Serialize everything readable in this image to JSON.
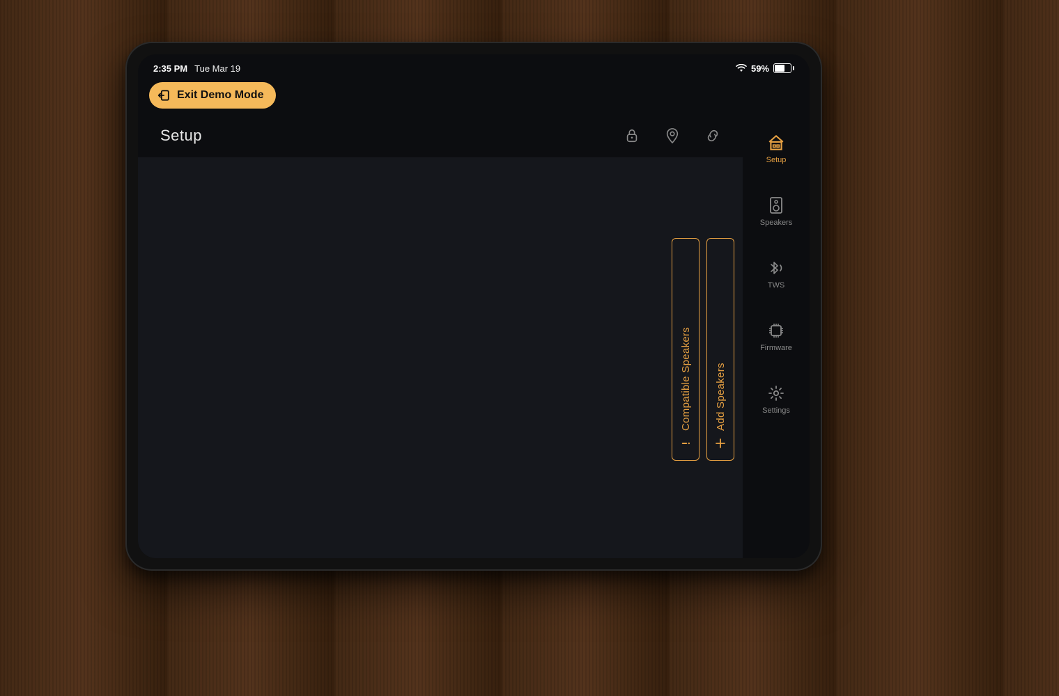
{
  "status": {
    "time": "2:35 PM",
    "date": "Tue Mar 19",
    "battery_pct": "59%"
  },
  "exit_button_label": "Exit Demo Mode",
  "page_title": "Setup",
  "side_tabs": {
    "compatible": "Compatible Speakers",
    "add": "Add Speakers"
  },
  "nav": {
    "setup": "Setup",
    "speakers": "Speakers",
    "tws": "TWS",
    "firmware": "Firmware",
    "settings": "Settings"
  },
  "colors": {
    "accent": "#e6a042",
    "bg_dark": "#0c0d10",
    "panel": "#15171c"
  }
}
